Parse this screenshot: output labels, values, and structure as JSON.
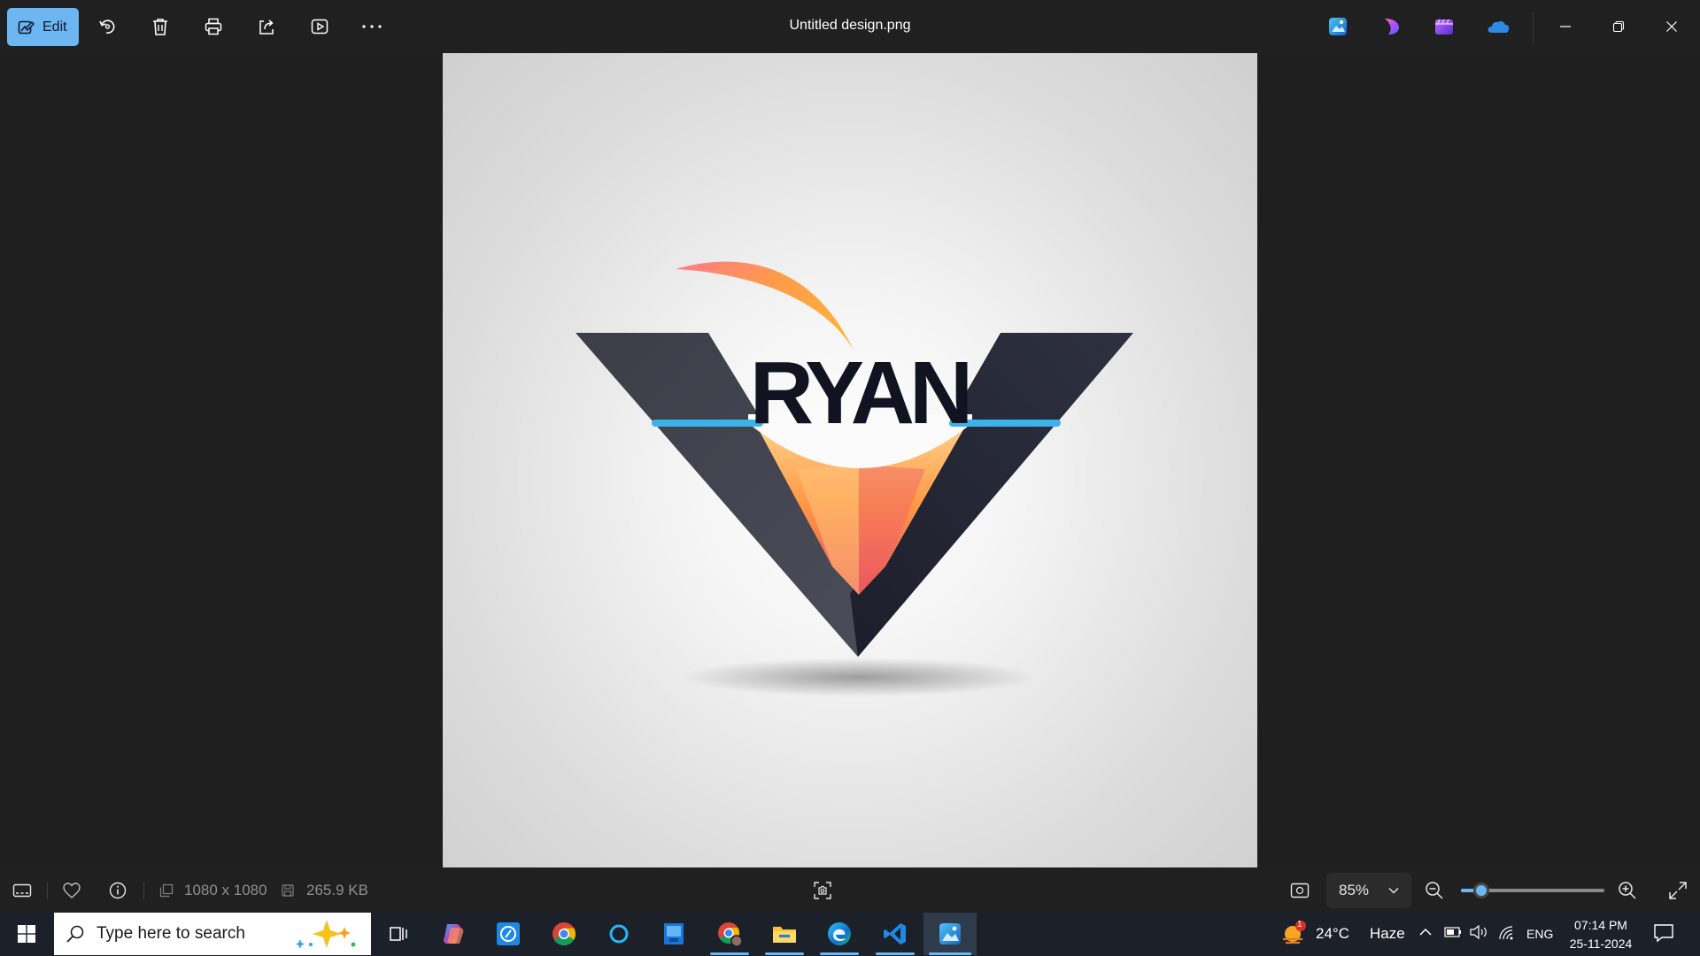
{
  "titlebar": {
    "edit_label": "Edit",
    "window_title": "Untitled design.png"
  },
  "image": {
    "logo_text": "RYAN"
  },
  "statusbar": {
    "dimensions": "1080 x 1080",
    "file_size": "265.9 KB",
    "zoom_value": "85%",
    "zoom_level": 0.14
  },
  "taskbar": {
    "search_placeholder": "Type here to search",
    "weather_temp": "24°C",
    "weather_desc": "Haze",
    "weather_badge": "1",
    "language": "ENG",
    "time": "07:14 PM",
    "date": "25-11-2024"
  },
  "colors": {
    "accent": "#6cb6f2",
    "toolbar_bg": "#202020",
    "taskbar_bg": "#1b2029"
  }
}
